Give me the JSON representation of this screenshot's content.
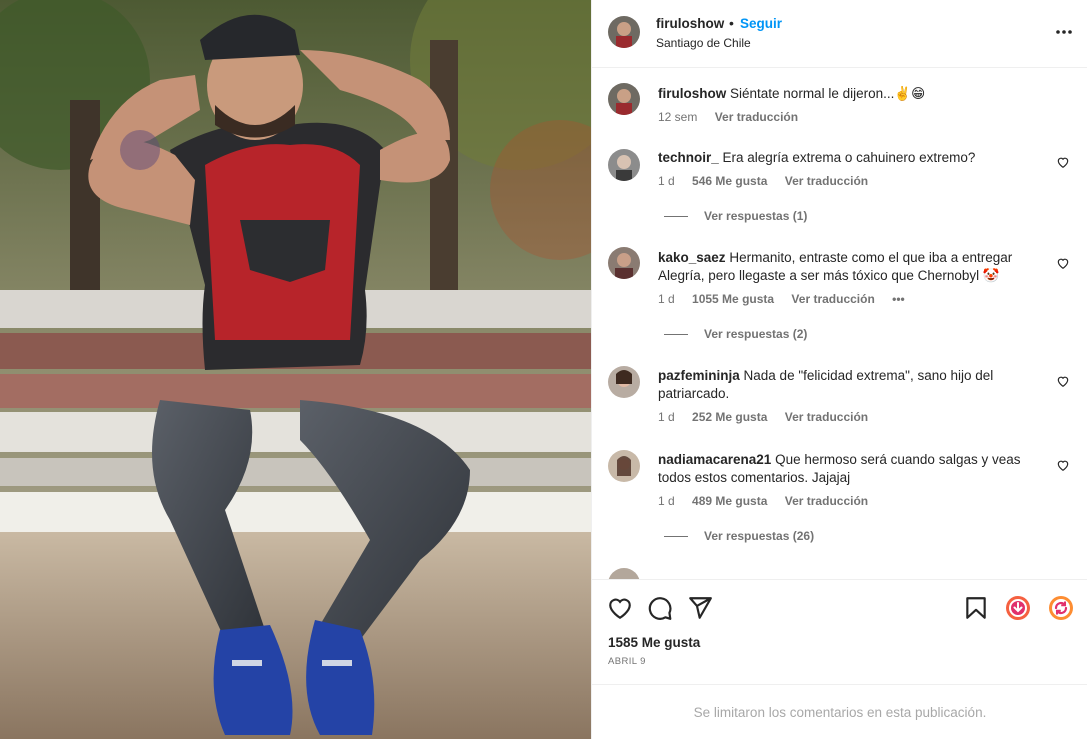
{
  "header": {
    "username": "firuloshow",
    "separator": "•",
    "follow_label": "Seguir",
    "location": "Santiago de Chile"
  },
  "caption": {
    "username": "firuloshow",
    "text": "Siéntate normal le dijeron...✌️😁",
    "time": "12 sem",
    "translate": "Ver traducción"
  },
  "comments": [
    {
      "username": "technoir_",
      "text": "Era alegría extrema o cahuinero extremo?",
      "time": "1 d",
      "likes": "546 Me gusta",
      "translate": "Ver traducción",
      "replies": "Ver respuestas (1)"
    },
    {
      "username": "kako_saez",
      "text": "Hermanito, entraste como el que iba a entregar Alegría, pero llegaste a ser más tóxico que Chernobyl 🤡",
      "time": "1 d",
      "likes": "1055 Me gusta",
      "translate": "Ver traducción",
      "more": "•••",
      "replies": "Ver respuestas (2)"
    },
    {
      "username": "pazfemininja",
      "text": "Nada de \"felicidad extrema\", sano hijo del patriarcado.",
      "time": "1 d",
      "likes": "252 Me gusta",
      "translate": "Ver traducción"
    },
    {
      "username": "nadiamacarena21",
      "text": "Que hermoso será cuando salgas y veas todos estos comentarios. Jajajaj",
      "time": "1 d",
      "likes": "489 Me gusta",
      "translate": "Ver traducción",
      "replies": "Ver respuestas (26)"
    }
  ],
  "footer": {
    "likes": "1585 Me gusta",
    "date": "ABRIL 9",
    "limited_notice": "Se limitaron los comentarios en esta publicación."
  },
  "colors": {
    "accent": "#0095f6",
    "secondary_text": "#737373",
    "divider": "#efefef"
  },
  "icons": [
    "heart-icon",
    "comment-icon",
    "share-icon",
    "bookmark-icon",
    "download-extension-icon",
    "refresh-extension-icon",
    "more-options-icon"
  ]
}
